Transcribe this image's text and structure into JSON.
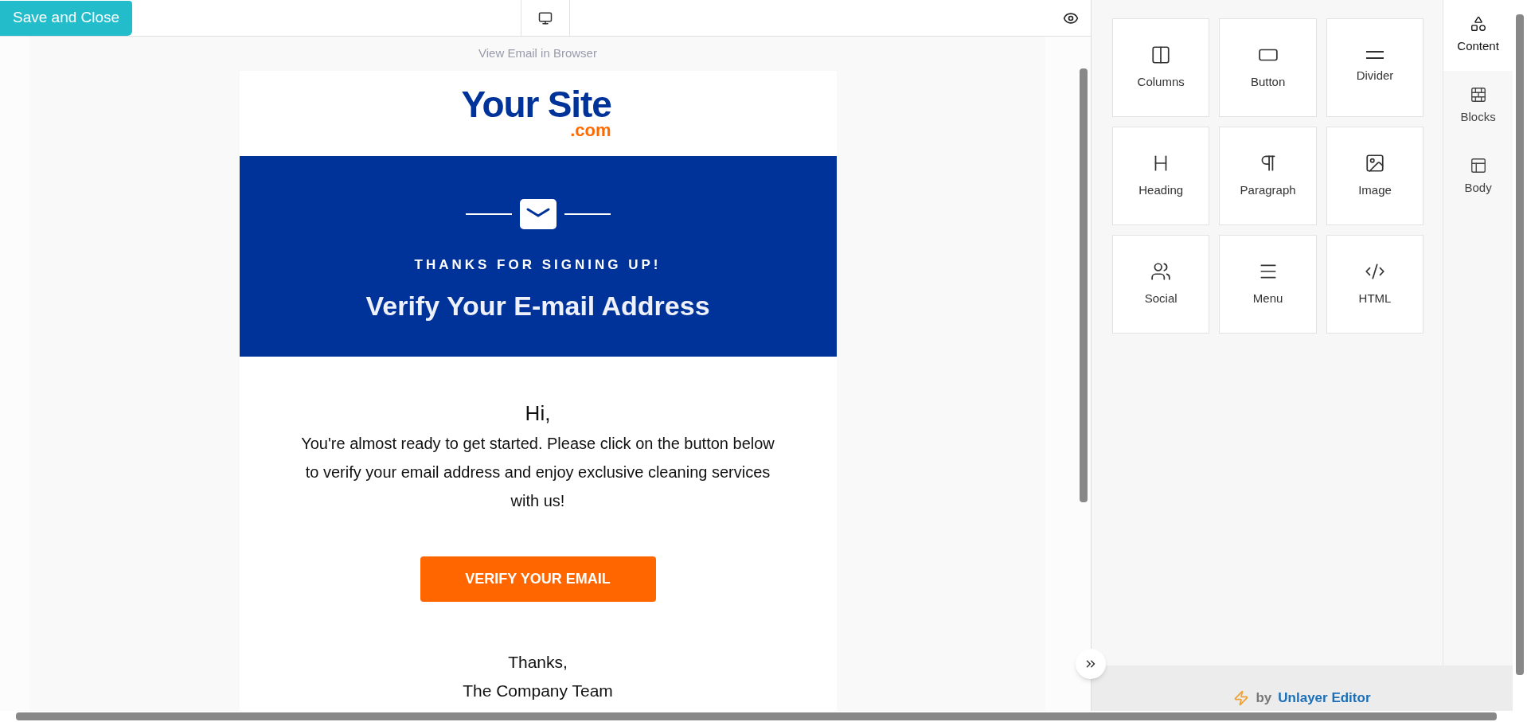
{
  "toolbar": {
    "save_button": "Save and Close"
  },
  "canvas": {
    "view_in_browser": "View Email in Browser",
    "logo": {
      "name": "Your Site",
      "suffix": ".com"
    },
    "banner": {
      "eyebrow": "THANKS FOR SIGNING UP!",
      "title": "Verify Your E-mail Address"
    },
    "greeting": "Hi,",
    "body": "You're almost ready to get started. Please click on the button below to verify your email address and enjoy exclusive cleaning services with us!",
    "cta": "VERIFY YOUR EMAIL",
    "signoff": [
      "Thanks,",
      "The Company Team"
    ]
  },
  "tools": [
    {
      "label": "Columns",
      "kind": "columns"
    },
    {
      "label": "Button",
      "kind": "button"
    },
    {
      "label": "Divider",
      "kind": "divider"
    },
    {
      "label": "Heading",
      "kind": "heading"
    },
    {
      "label": "Paragraph",
      "kind": "paragraph"
    },
    {
      "label": "Image",
      "kind": "image"
    },
    {
      "label": "Social",
      "kind": "social"
    },
    {
      "label": "Menu",
      "kind": "menu"
    },
    {
      "label": "HTML",
      "kind": "html"
    }
  ],
  "side_tabs": [
    {
      "label": "Content",
      "kind": "content",
      "selected": true
    },
    {
      "label": "Blocks",
      "kind": "blocks",
      "selected": false
    },
    {
      "label": "Body",
      "kind": "body",
      "selected": false
    }
  ],
  "footer": {
    "by": "by",
    "brand": "Unlayer Editor"
  }
}
